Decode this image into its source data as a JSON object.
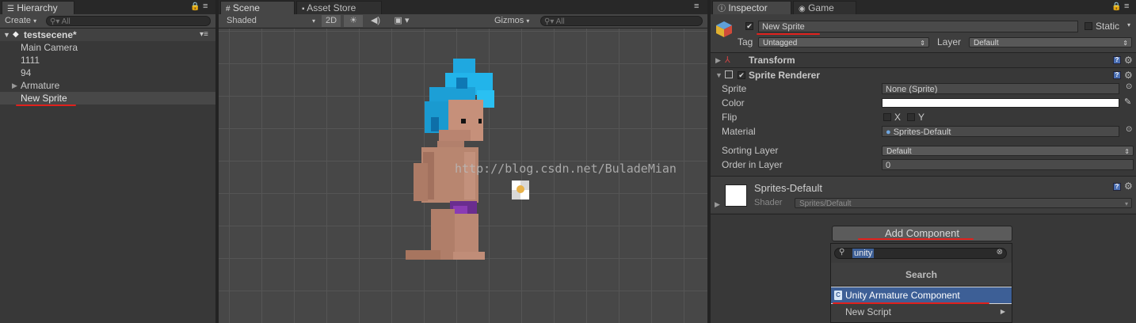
{
  "hierarchy": {
    "tab": "Hierarchy",
    "create_label": "Create",
    "search_placeholder": "All",
    "scene_name": "testsecene*",
    "items": [
      "Main Camera",
      "1111",
      "94",
      "Armature",
      "New Sprite"
    ]
  },
  "scene": {
    "tabs": [
      "Scene",
      "Asset Store"
    ],
    "shading": "Shaded",
    "mode_2d": "2D",
    "gizmos": "Gizmos",
    "search_placeholder": "All",
    "watermark": "http://blog.csdn.net/BuladeMian"
  },
  "inspector": {
    "tabs": [
      "Inspector",
      "Game"
    ],
    "object_name": "New Sprite",
    "static_label": "Static",
    "tag_label": "Tag",
    "tag_value": "Untagged",
    "layer_label": "Layer",
    "layer_value": "Default",
    "transform_title": "Transform",
    "sprite_renderer_title": "Sprite Renderer",
    "fields": {
      "sprite_label": "Sprite",
      "sprite_value": "None (Sprite)",
      "color_label": "Color",
      "flip_label": "Flip",
      "flip_x": "X",
      "flip_y": "Y",
      "material_label": "Material",
      "material_value": "Sprites-Default",
      "sorting_layer_label": "Sorting Layer",
      "sorting_layer_value": "Default",
      "order_label": "Order in Layer",
      "order_value": "0"
    },
    "material_block": {
      "name": "Sprites-Default",
      "shader_label": "Shader",
      "shader_value": "Sprites/Default"
    },
    "add_component_label": "Add Component",
    "ac_search_value": "unity",
    "ac_search_header": "Search",
    "ac_results": [
      "Unity Armature Component",
      "New Script"
    ]
  },
  "colors": {
    "accent_selection": "#3d5f96",
    "annotation_red": "#e0201c"
  }
}
